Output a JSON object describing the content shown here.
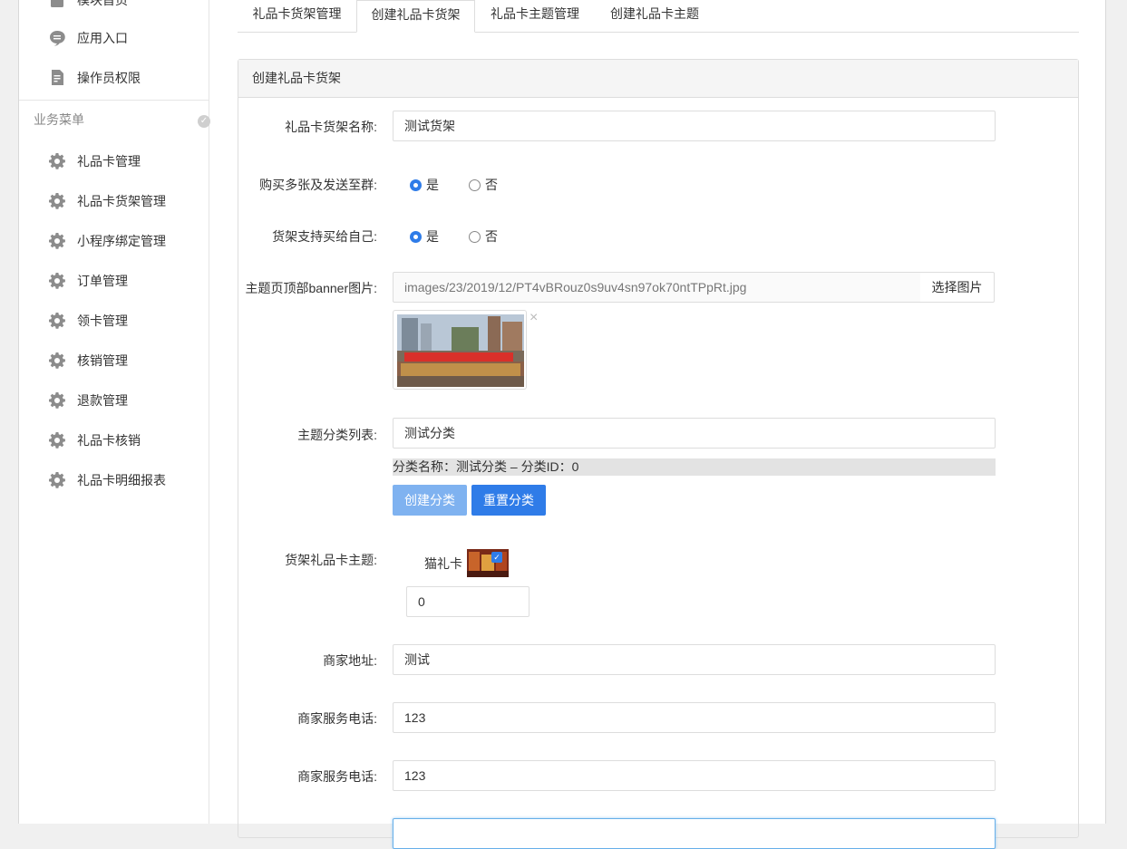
{
  "sidebar": {
    "top_items": [
      {
        "label": "模块首页",
        "icon": "document-icon"
      },
      {
        "label": "应用入口",
        "icon": "chat-bubble-icon"
      },
      {
        "label": "操作员权限",
        "icon": "document-edit-icon"
      }
    ],
    "section_title": "业务菜单",
    "items": [
      {
        "label": "礼品卡管理",
        "icon": "gear-icon"
      },
      {
        "label": "礼品卡货架管理",
        "icon": "gear-icon"
      },
      {
        "label": "小程序绑定管理",
        "icon": "gear-icon"
      },
      {
        "label": "订单管理",
        "icon": "gear-icon"
      },
      {
        "label": "领卡管理",
        "icon": "gear-icon"
      },
      {
        "label": "核销管理",
        "icon": "gear-icon"
      },
      {
        "label": "退款管理",
        "icon": "gear-icon"
      },
      {
        "label": "礼品卡核销",
        "icon": "gear-icon"
      },
      {
        "label": "礼品卡明细报表",
        "icon": "gear-icon"
      }
    ]
  },
  "tabs": [
    {
      "label": "礼品卡货架管理",
      "active": false
    },
    {
      "label": "创建礼品卡货架",
      "active": true
    },
    {
      "label": "礼品卡主题管理",
      "active": false
    },
    {
      "label": "创建礼品卡主题",
      "active": false
    }
  ],
  "form": {
    "panel_title": "创建礼品卡货架",
    "shelf_name": {
      "label": "礼品卡货架名称:",
      "value": "测试货架"
    },
    "buy_multiple": {
      "label": "购买多张及发送至群:",
      "yes": "是",
      "no": "否",
      "selected": "是"
    },
    "buy_for_self": {
      "label": "货架支持买给自己:",
      "yes": "是",
      "no": "否",
      "selected": "是"
    },
    "banner": {
      "label": "主题页顶部banner图片:",
      "value": "images/23/2019/12/PT4vBRouz0s9uv4sn97ok70ntTPpRt.jpg",
      "select_button": "选择图片",
      "remove": "×"
    },
    "category": {
      "label": "主题分类列表:",
      "value": "测试分类",
      "info": "分类名称：测试分类 – 分类ID：0",
      "create_button": "创建分类",
      "reset_button": "重置分类"
    },
    "theme": {
      "label": "货架礼品卡主题:",
      "name": "猫礼卡",
      "sort_value": "0",
      "checked": true
    },
    "merchant_address": {
      "label": "商家地址:",
      "value": "测试"
    },
    "service_phone_1": {
      "label": "商家服务电话:",
      "value": "123"
    },
    "service_phone_2": {
      "label": "商家服务电话:",
      "value": "123"
    }
  },
  "colors": {
    "primary": "#2f7ce8",
    "primary_light": "#7fb2f0"
  }
}
